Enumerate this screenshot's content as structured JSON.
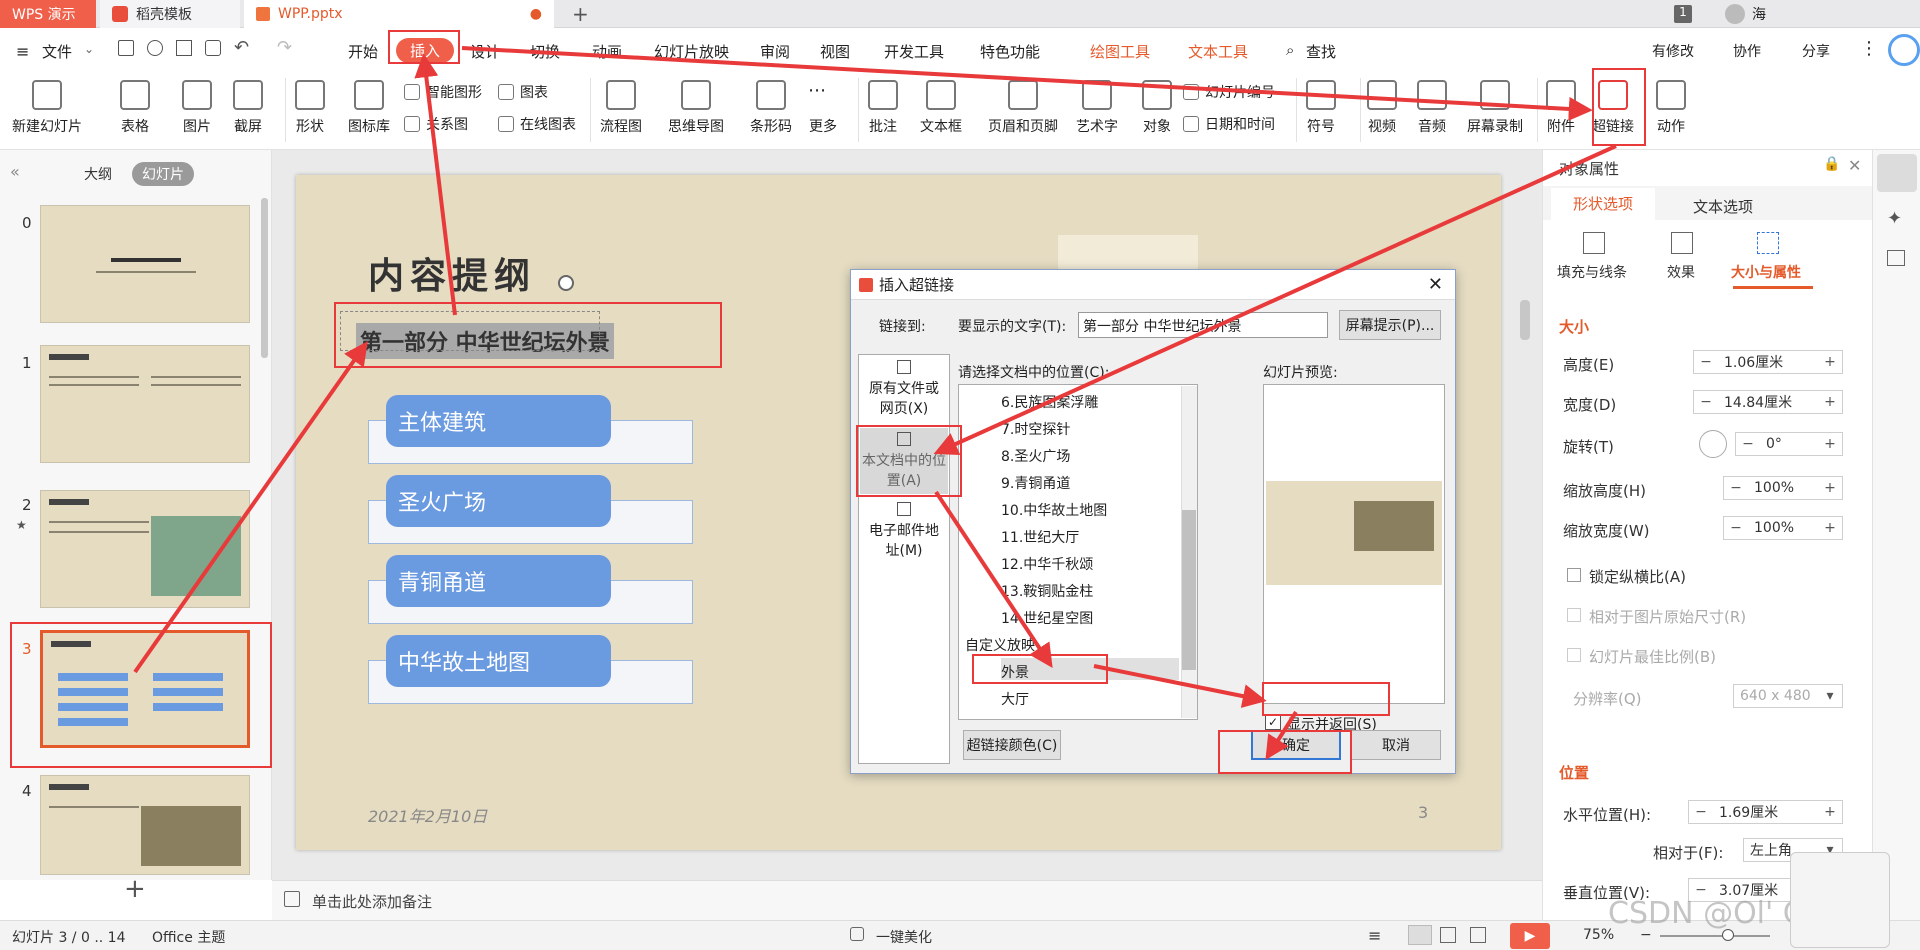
{
  "titlebar": {
    "app": "WPS 演示",
    "tab1": "稻壳模板",
    "tab2": "WPP.pptx",
    "badge": "1",
    "user": "海"
  },
  "menu": {
    "file": "文件",
    "items": [
      "开始",
      "插入",
      "设计",
      "切换",
      "动画",
      "幻灯片放映",
      "审阅",
      "视图",
      "开发工具",
      "特色功能",
      "绘图工具",
      "文本工具",
      "查找"
    ],
    "right": [
      "有修改",
      "协作",
      "分享"
    ]
  },
  "ribbon": {
    "items": [
      "新建幻灯片",
      "表格",
      "图片",
      "截屏",
      "形状",
      "图标库",
      "智能图形",
      "关系图",
      "图表",
      "在线图表",
      "流程图",
      "思维导图",
      "条形码",
      "更多",
      "批注",
      "文本框",
      "页眉和页脚",
      "艺术字",
      "对象",
      "幻灯片编号",
      "日期和时间",
      "符号",
      "视频",
      "音频",
      "屏幕录制",
      "附件",
      "超链接",
      "动作"
    ]
  },
  "leftpanel": {
    "tabs": [
      "大纲",
      "幻灯片"
    ],
    "numbers": [
      "0",
      "1",
      "2",
      "3",
      "4"
    ],
    "add": "+"
  },
  "slide": {
    "title": "内容提纲",
    "subtitle": "第一部分 中华世纪坛外景",
    "boxes": [
      "主体建筑",
      "圣火广场",
      "青铜甬道",
      "中华故土地图"
    ],
    "date": "2021年2月10日",
    "page": "3",
    "note": "单击此处添加备注"
  },
  "dialog": {
    "title": "插入超链接",
    "link_to": "链接到:",
    "display_label": "要显示的文字(T):",
    "display_value": "第一部分 中华世纪坛外景",
    "screentip": "屏幕提示(P)...",
    "sidebar": [
      "原有文件或网页(X)",
      "本文档中的位置(A)",
      "电子邮件地址(M)"
    ],
    "list_label": "请选择文档中的位置(C):",
    "list": [
      "6.民族图案浮雕",
      "7.时空探针",
      "8.圣火广场",
      "9.青铜甬道",
      "10.中华故土地图",
      "11.世纪大厅",
      "12.中华千秋颂",
      "13.鞍铜贴金柱",
      "14.世纪星空图",
      "自定义放映",
      "外景",
      "大厅"
    ],
    "preview_label": "幻灯片预览:",
    "show_return": "显示并返回(S)",
    "color_btn": "超链接颜色(C)",
    "ok": "确定",
    "cancel": "取消"
  },
  "rightpanel": {
    "header": "对象属性",
    "tabs": [
      "形状选项",
      "文本选项"
    ],
    "subtabs": [
      "填充与线条",
      "效果",
      "大小与属性"
    ],
    "size_section": "大小",
    "height_label": "高度(E)",
    "height": "1.06厘米",
    "width_label": "宽度(D)",
    "width": "14.84厘米",
    "rotate_label": "旋转(T)",
    "rotate": "0°",
    "scale_h_label": "缩放高度(H)",
    "scale_h": "100%",
    "scale_w_label": "缩放宽度(W)",
    "scale_w": "100%",
    "lock": "锁定纵横比(A)",
    "relative": "相对于图片原始尺寸(R)",
    "best": "幻灯片最佳比例(B)",
    "res_label": "分辨率(Q)",
    "res": "640 x 480",
    "pos_section": "位置",
    "hpos_label": "水平位置(H):",
    "hpos": "1.69厘米",
    "rel_label": "相对于(F):",
    "rel": "左上角",
    "vpos_label": "垂直位置(V):",
    "vpos": "3.07厘米"
  },
  "statusbar": {
    "slide": "幻灯片 3 / 0 .. 14",
    "theme": "Office 主题",
    "beautify": "一键美化",
    "zoom": "75%"
  },
  "watermark": "CSDN @Ol' Corre",
  "colors": {
    "accent": "#ef5f4a",
    "annotation": "#e83a3a",
    "box": "#6a9ae0"
  }
}
